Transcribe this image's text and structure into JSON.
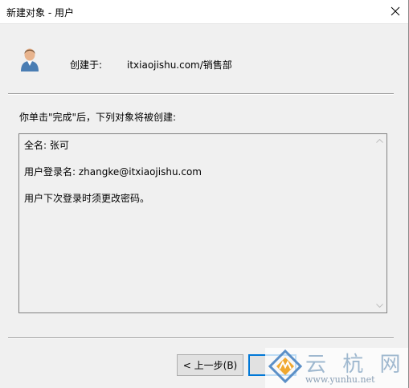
{
  "window": {
    "title": "新建对象 - 用户",
    "close_icon": "close-icon"
  },
  "header": {
    "icon": "user-icon",
    "created_label": "创建于:",
    "created_path": "itxiaojishu.com/销售部"
  },
  "instruction": "你单击\"完成\"后，下列对象将被创建:",
  "summary": {
    "lines": [
      "全名: 张可",
      "用户登录名: zhangke@itxiaojishu.com",
      "用户下次登录时须更改密码。"
    ]
  },
  "buttons": {
    "back_label": "< 上一步(B)",
    "finish_label": ""
  },
  "watermark": {
    "title": "云 杭 网",
    "url": "www.yunhu.net"
  },
  "colors": {
    "background": "#f0f0f0",
    "titlebar": "#ffffff",
    "accent": "#0078d7"
  }
}
